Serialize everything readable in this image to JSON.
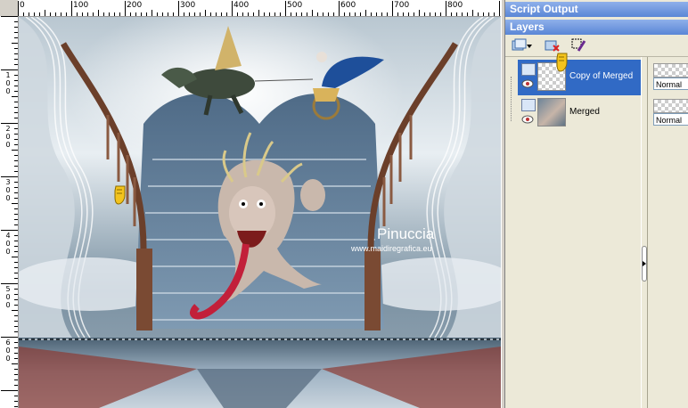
{
  "ruler_top": {
    "labels": [
      "0",
      "100",
      "200",
      "300",
      "400",
      "500",
      "600",
      "700",
      "800"
    ]
  },
  "ruler_left": {
    "labels": [
      "",
      "1 0 0",
      "2 0 0",
      "3 0 0",
      "4 0 0",
      "5 0 0",
      "6 0 0"
    ]
  },
  "canvas": {
    "watermark_name": "Pinuccia",
    "watermark_url": "www.maidiregrafica.eu"
  },
  "panels": {
    "script_output_title": "Script Output",
    "layers_title": "Layers"
  },
  "toolbar_icons": [
    "new-layer-icon",
    "dropdown-arrow-icon",
    "delete-layer-icon",
    "edit-selection-icon"
  ],
  "layers": [
    {
      "name": "Copy of Merged",
      "selected": true,
      "blend": "Normal"
    },
    {
      "name": "Merged",
      "selected": false,
      "blend": "Normal"
    }
  ],
  "colors": {
    "panel_title": "#5a86d6",
    "selection": "#316ac5"
  }
}
